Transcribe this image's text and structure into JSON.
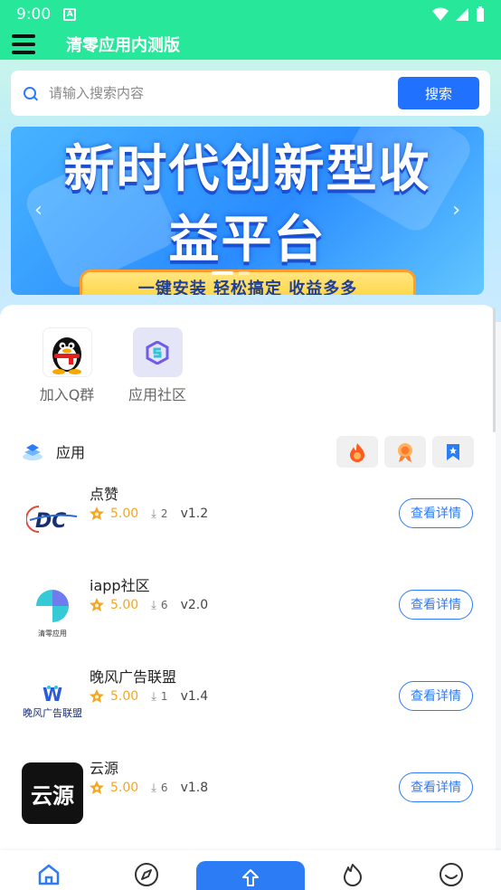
{
  "status_bar": {
    "time": "9:00"
  },
  "app": {
    "title": "清零应用内测版"
  },
  "search": {
    "placeholder": "请输入搜索内容",
    "button_label": "搜索"
  },
  "banner": {
    "line1": "新时代创新型收",
    "line2": "益平台",
    "strip": "一键安装 轻松搞定 收益多多"
  },
  "quick_links": [
    {
      "label": "加入Q群",
      "icon": "qq-penguin-icon"
    },
    {
      "label": "应用社区",
      "icon": "community-logo-icon"
    }
  ],
  "section": {
    "title": "应用",
    "tabs": [
      "hot-fire-icon",
      "award-medal-icon",
      "bookmark-star-icon"
    ]
  },
  "apps": [
    {
      "name": "点赞",
      "rating": "5.00",
      "downloads": "2",
      "version": "v1.2",
      "button": "查看详情",
      "logo": "dc-logo"
    },
    {
      "name": "iapp社区",
      "rating": "5.00",
      "downloads": "6",
      "version": "v2.0",
      "button": "查看详情",
      "logo": "qingling-logo",
      "logo_text": "清零应用"
    },
    {
      "name": "晚风广告联盟",
      "rating": "5.00",
      "downloads": "1",
      "version": "v1.4",
      "button": "查看详情",
      "logo": "wanfeng-logo",
      "logo_text": "晚风广告联盟"
    },
    {
      "name": "云源",
      "rating": "5.00",
      "downloads": "6",
      "version": "v1.8",
      "button": "查看详情",
      "logo": "yunyuan-logo",
      "logo_text": "云源"
    }
  ],
  "bottom_nav": [
    "home-icon",
    "navigate-icon",
    "upload-icon",
    "fire-icon",
    "smile-icon"
  ],
  "colors": {
    "accent_green": "#27e79a",
    "primary_blue": "#2171ff",
    "rating_orange": "#f5a623"
  }
}
